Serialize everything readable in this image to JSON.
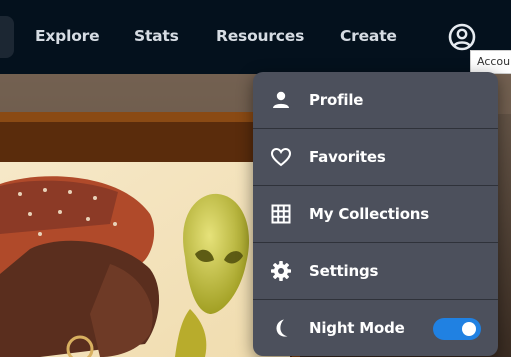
{
  "nav": {
    "links": [
      "Explore",
      "Stats",
      "Resources",
      "Create"
    ],
    "account_tooltip": "Account"
  },
  "menu": {
    "items": [
      {
        "label": "Profile",
        "icon": "person-icon"
      },
      {
        "label": "Favorites",
        "icon": "heart-icon"
      },
      {
        "label": "My Collections",
        "icon": "grid-icon"
      },
      {
        "label": "Settings",
        "icon": "gear-icon"
      },
      {
        "label": "Night Mode",
        "icon": "moon-icon"
      }
    ],
    "night_mode_on": true
  },
  "colors": {
    "nav_bg": "#04111d",
    "menu_bg": "#4c505c",
    "toggle_on": "#2081e2"
  }
}
